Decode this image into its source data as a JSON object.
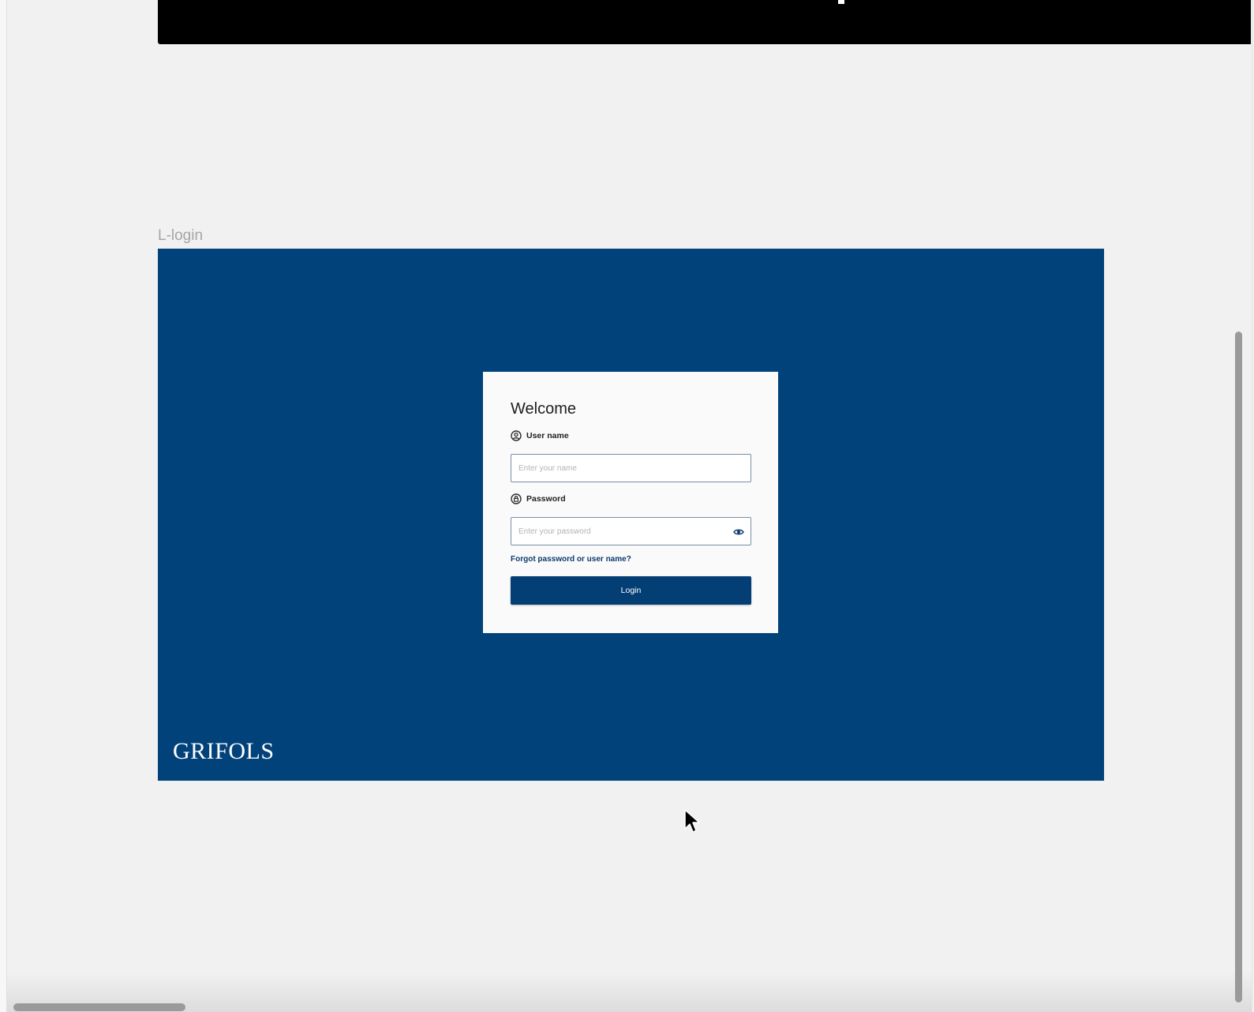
{
  "frame_label": "L-login",
  "login": {
    "title": "Welcome",
    "username_label": "User name",
    "username_placeholder": "Enter your name",
    "password_label": "Password",
    "password_placeholder": "Enter your password",
    "forgot_link": "Forgot password or user name?",
    "login_button": "Login",
    "brand": "GRIFOLS"
  },
  "colors": {
    "brand_background": "#02427b",
    "button": "#033e75",
    "link": "#0c3b6e",
    "canvas": "#f1f1f1"
  },
  "icons": {
    "username": "user-circle-icon",
    "password": "lock-circle-icon",
    "reveal": "eye-icon",
    "pointer": "mouse-pointer-icon"
  }
}
